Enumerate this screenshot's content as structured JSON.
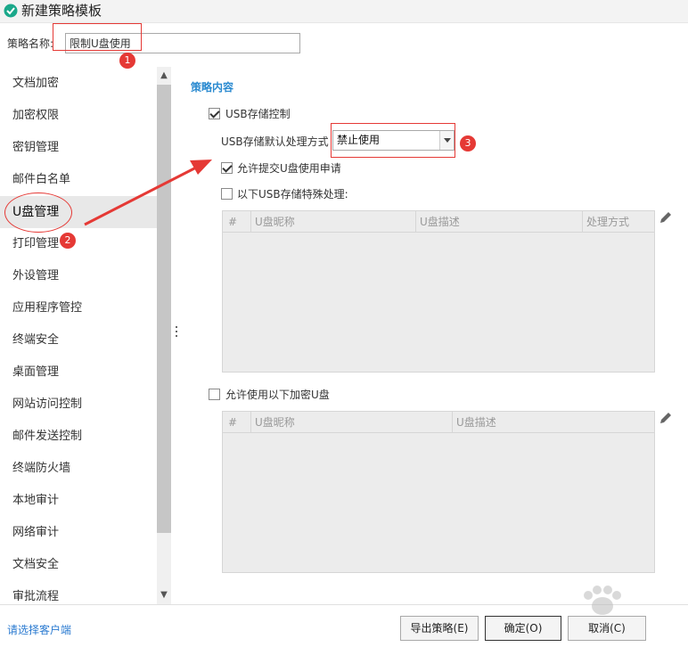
{
  "window": {
    "title": "新建策略模板"
  },
  "namebar": {
    "label": "策略名称:",
    "value": "限制U盘使用"
  },
  "sidebar": {
    "items": [
      {
        "label": "文档加密"
      },
      {
        "label": "加密权限"
      },
      {
        "label": "密钥管理"
      },
      {
        "label": "邮件白名单"
      },
      {
        "label": "U盘管理",
        "active": true
      },
      {
        "label": "打印管理"
      },
      {
        "label": "外设管理"
      },
      {
        "label": "应用程序管控"
      },
      {
        "label": "终端安全"
      },
      {
        "label": "桌面管理"
      },
      {
        "label": "网站访问控制"
      },
      {
        "label": "邮件发送控制"
      },
      {
        "label": "终端防火墙"
      },
      {
        "label": "本地审计"
      },
      {
        "label": "网络审计"
      },
      {
        "label": "文档安全"
      },
      {
        "label": "审批流程"
      }
    ]
  },
  "content": {
    "section_title": "策略内容",
    "usb_control": {
      "label": "USB存储控制",
      "checked": true
    },
    "default_action": {
      "label": "USB存储默认处理方式",
      "value": "禁止使用"
    },
    "allow_request": {
      "label": "允许提交U盘使用申请",
      "checked": true
    },
    "special_handling": {
      "label": "以下USB存储特殊处理:",
      "checked": false
    },
    "table1": {
      "columns": [
        "#",
        "U盘昵称",
        "U盘描述",
        "处理方式"
      ],
      "rows": []
    },
    "allow_encrypted": {
      "label": "允许使用以下加密U盘",
      "checked": false
    },
    "table2": {
      "columns": [
        "#",
        "U盘昵称",
        "U盘描述"
      ],
      "rows": []
    }
  },
  "footer": {
    "client_link": "请选择客户端",
    "export_button": "导出策略(E)",
    "ok_button": "确定(O)",
    "cancel_button": "取消(C)"
  },
  "annotations": {
    "marker1": "1",
    "marker2": "2",
    "marker3": "3"
  },
  "colors": {
    "accent": "#2a8ad0",
    "annotation": "#e53935",
    "active_item": "#e8e8e8"
  }
}
